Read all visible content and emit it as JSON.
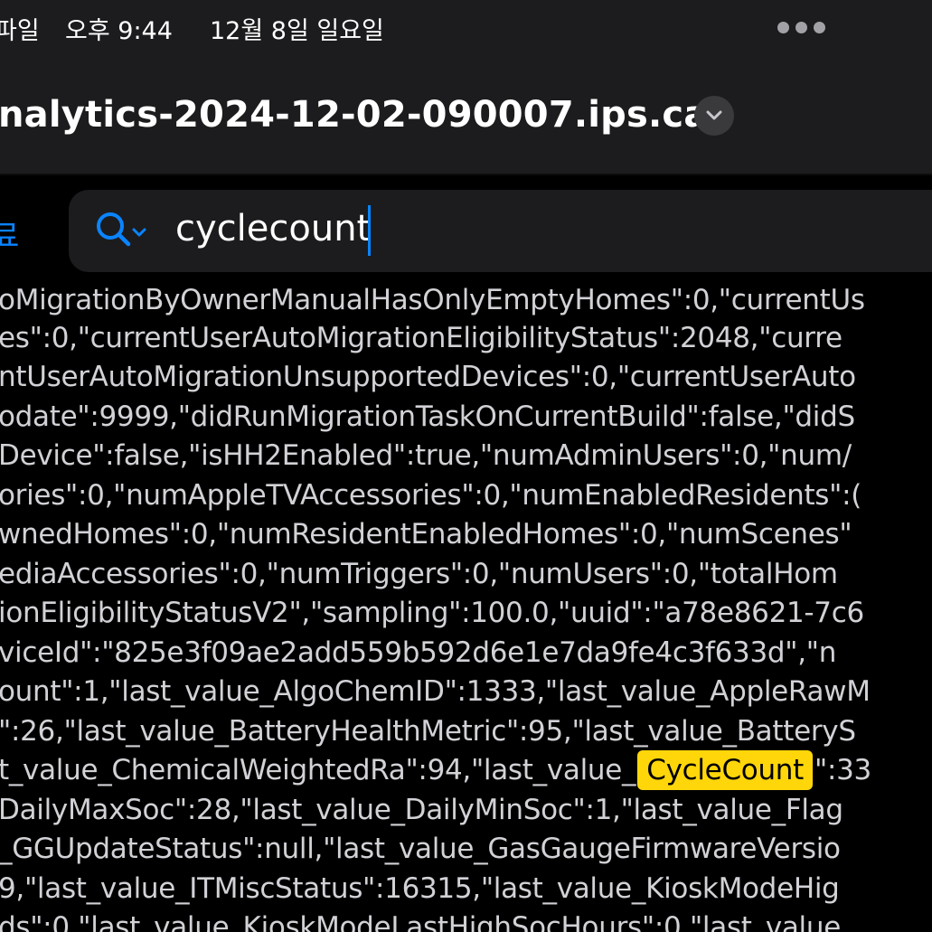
{
  "status_bar": {
    "app_name": "파일",
    "time": "오후 9:44",
    "date": "12월 8일 일요일"
  },
  "document": {
    "title": "nalytics-2024-12-02-090007.ips.ca"
  },
  "find_bar": {
    "done_label": "료",
    "query": "cyclecount"
  },
  "colors": {
    "accent": "#0a84ff",
    "highlight": "#ffd60a"
  },
  "log_lines": [
    {
      "text": "oMigrationByOwnerManualHasOnlyEmptyHomes\":0,\"currentUs"
    },
    {
      "text": "es\":0,\"currentUserAutoMigrationEligibilityStatus\":2048,\"curre"
    },
    {
      "text": "ntUserAutoMigrationUnsupportedDevices\":0,\"currentUserAuto"
    },
    {
      "text": "odate\":9999,\"didRunMigrationTaskOnCurrentBuild\":false,\"didS"
    },
    {
      "text": "Device\":false,\"isHH2Enabled\":true,\"numAdminUsers\":0,\"num/"
    },
    {
      "text": "ories\":0,\"numAppleTVAccessories\":0,\"numEnabledResidents\":("
    },
    {
      "text": "wnedHomes\":0,\"numResidentEnabledHomes\":0,\"numScenes\""
    },
    {
      "text": "ediaAccessories\":0,\"numTriggers\":0,\"numUsers\":0,\"totalHom"
    },
    {
      "text": "ionEligibilityStatusV2\",\"sampling\":100.0,\"uuid\":\"a78e8621-7c6"
    },
    {
      "text": "viceId\":\"825e3f09ae2add559b592d6e1e7da9fe4c3f633d\",\"n"
    },
    {
      "text": "ount\":1,\"last_value_AlgoChemID\":1333,\"last_value_AppleRawM"
    },
    {
      "text": "\":26,\"last_value_BatteryHealthMetric\":95,\"last_value_BatteryS"
    },
    {
      "text": "t_value_ChemicalWeightedRa\":94,\"last_value_",
      "match": "CycleCount",
      "after": "\":33"
    },
    {
      "text": "DailyMaxSoc\":28,\"last_value_DailyMinSoc\":1,\"last_value_Flag"
    },
    {
      "text": "_GGUpdateStatus\":null,\"last_value_GasGaugeFirmwareVersio"
    },
    {
      "text": "9,\"last_value_ITMiscStatus\":16315,\"last_value_KioskModeHig"
    },
    {
      "text": "ds\":0,\"last_value_KioskModeLastHighSocHours\":0,\"last_value"
    }
  ]
}
